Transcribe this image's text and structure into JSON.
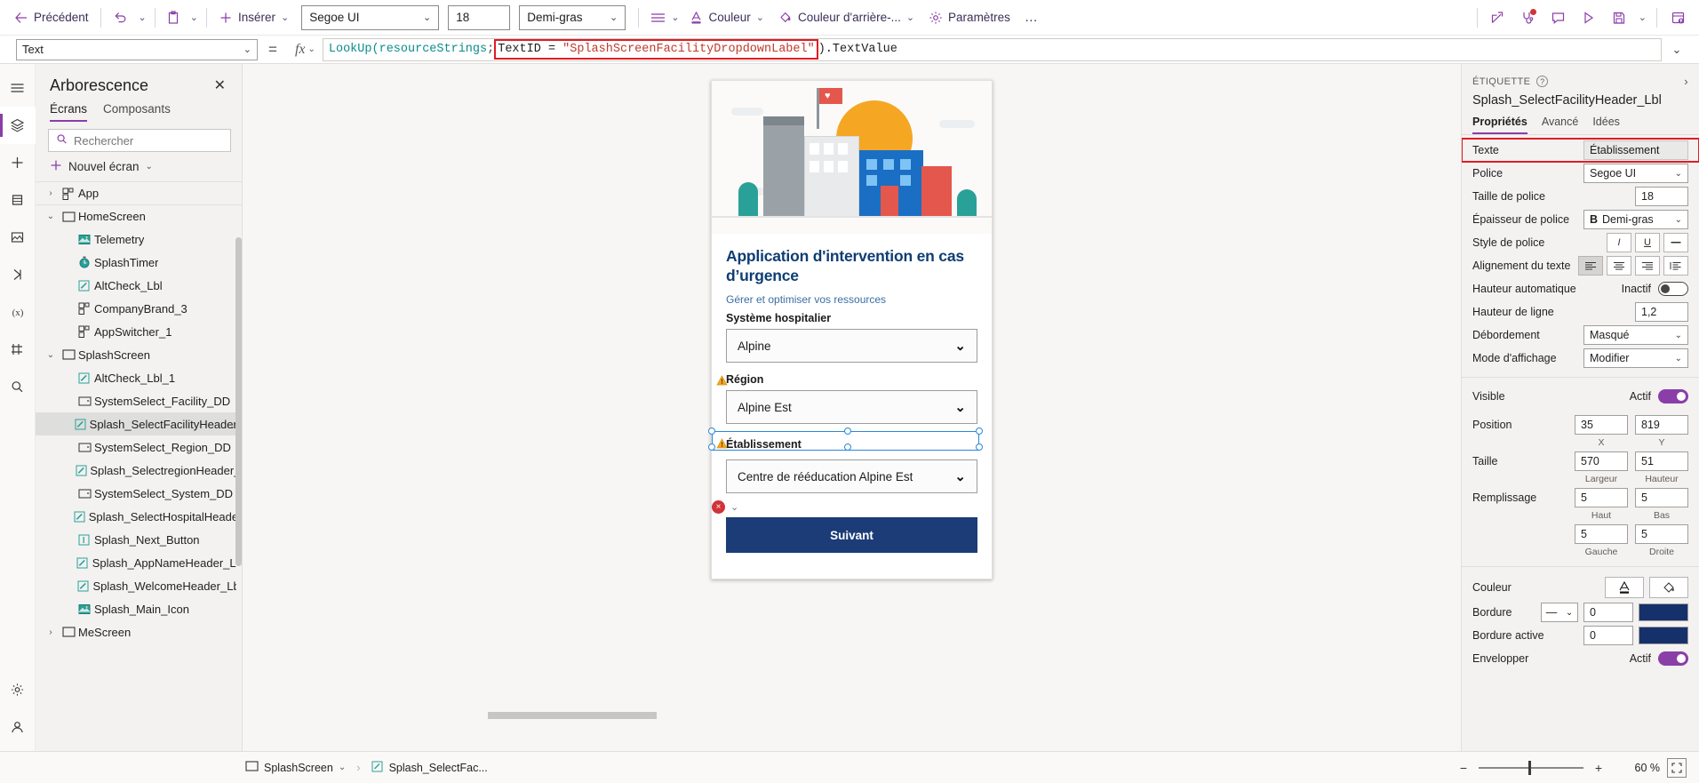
{
  "toolbar": {
    "back_label": "Précédent",
    "undo_icon": "undo-icon",
    "paste_icon": "paste-icon",
    "insert_label": "Insérer",
    "font_value": "Segoe UI",
    "font_size_value": "18",
    "font_weight_value": "Demi-gras",
    "align_icon": "align-icon",
    "color_label": "Couleur",
    "fill_label": "Couleur d'arrière-...",
    "settings_label": "Paramètres",
    "overflow_label": "…",
    "right_icons": [
      {
        "name": "share-icon",
        "glyph": "share"
      },
      {
        "name": "app-checker-icon",
        "glyph": "stethoscope",
        "badge": true
      },
      {
        "name": "comments-icon",
        "glyph": "comment"
      },
      {
        "name": "preview-icon",
        "glyph": "play"
      },
      {
        "name": "save-icon",
        "glyph": "save"
      },
      {
        "name": "save-dropdown-icon",
        "glyph": "chevron"
      },
      {
        "name": "publish-icon",
        "glyph": "publish"
      }
    ]
  },
  "formula_bar": {
    "property_value": "Text",
    "equals": "=",
    "fx_label": "fx",
    "formula_prefix": "LookUp(",
    "formula_table": "resourceStrings",
    "formula_semicolon": "; ",
    "formula_highlight": "TextID = \"SplashScreenFacilityDropdownLabel\"",
    "formula_highlight_id": "TextID = ",
    "formula_highlight_string": "\"SplashScreenFacilityDropdownLabel\"",
    "formula_suffix": ").TextValue",
    "expand_icon": "chevron-down-icon"
  },
  "rail": {
    "items": [
      {
        "name": "menu-icon",
        "label": "Menu"
      },
      {
        "name": "tree-view-icon",
        "label": "Arborescence",
        "active": true
      },
      {
        "name": "insert-icon",
        "label": "Insérer"
      },
      {
        "name": "data-icon",
        "label": "Données"
      },
      {
        "name": "media-icon",
        "label": "Médias"
      },
      {
        "name": "power-automate-icon",
        "label": "Power Automate"
      },
      {
        "name": "variables-icon",
        "label": "Variables"
      },
      {
        "name": "components-icon",
        "label": "Composants"
      },
      {
        "name": "search-icon",
        "label": "Rechercher"
      }
    ],
    "bottom_items": [
      {
        "name": "settings-gear-icon",
        "label": "Paramètres"
      },
      {
        "name": "account-icon",
        "label": "Compte"
      }
    ]
  },
  "tree": {
    "title": "Arborescence",
    "close_icon": "close-icon",
    "tabs": [
      {
        "label": "Écrans",
        "active": true
      },
      {
        "label": "Composants",
        "active": false
      }
    ],
    "search_placeholder": "Rechercher",
    "search_value": "",
    "new_screen_label": "Nouvel écran",
    "items": [
      {
        "label": "App",
        "icon": "component-icon",
        "indent": 0,
        "twisty": "collapsed",
        "selected": false,
        "divider": true
      },
      {
        "label": "HomeScreen",
        "icon": "screen-icon",
        "indent": 0,
        "twisty": "expanded",
        "selected": false,
        "divider": true
      },
      {
        "label": "Telemetry",
        "icon": "image-icon",
        "indent": 1,
        "twisty": "",
        "selected": false,
        "divider": false
      },
      {
        "label": "SplashTimer",
        "icon": "timer-icon",
        "indent": 1,
        "twisty": "",
        "selected": false,
        "divider": false
      },
      {
        "label": "AltCheck_Lbl",
        "icon": "label-icon",
        "indent": 1,
        "twisty": "",
        "selected": false,
        "divider": false
      },
      {
        "label": "CompanyBrand_3",
        "icon": "component-icon",
        "indent": 1,
        "twisty": "",
        "selected": false,
        "divider": false
      },
      {
        "label": "AppSwitcher_1",
        "icon": "component-icon",
        "indent": 1,
        "twisty": "",
        "selected": false,
        "divider": false
      },
      {
        "label": "SplashScreen",
        "icon": "screen-icon",
        "indent": 0,
        "twisty": "expanded",
        "selected": false,
        "divider": false
      },
      {
        "label": "AltCheck_Lbl_1",
        "icon": "label-icon",
        "indent": 1,
        "twisty": "",
        "selected": false,
        "divider": false
      },
      {
        "label": "SystemSelect_Facility_DD",
        "icon": "dropdown-icon",
        "indent": 1,
        "twisty": "",
        "selected": false,
        "divider": false
      },
      {
        "label": "Splash_SelectFacilityHeader_Lbl",
        "icon": "label-icon",
        "indent": 1,
        "twisty": "",
        "selected": true,
        "divider": false,
        "dots": "…"
      },
      {
        "label": "SystemSelect_Region_DD",
        "icon": "dropdown-icon",
        "indent": 1,
        "twisty": "",
        "selected": false,
        "divider": false
      },
      {
        "label": "Splash_SelectregionHeader_Lbl",
        "icon": "label-icon",
        "indent": 1,
        "twisty": "",
        "selected": false,
        "divider": false
      },
      {
        "label": "SystemSelect_System_DD",
        "icon": "dropdown-icon",
        "indent": 1,
        "twisty": "",
        "selected": false,
        "divider": false
      },
      {
        "label": "Splash_SelectHospitalHeader_Lbl",
        "icon": "label-icon",
        "indent": 1,
        "twisty": "",
        "selected": false,
        "divider": false
      },
      {
        "label": "Splash_Next_Button",
        "icon": "button-icon",
        "indent": 1,
        "twisty": "",
        "selected": false,
        "divider": false
      },
      {
        "label": "Splash_AppNameHeader_Lbl",
        "icon": "label-icon",
        "indent": 1,
        "twisty": "",
        "selected": false,
        "divider": false
      },
      {
        "label": "Splash_WelcomeHeader_Lbl",
        "icon": "label-icon",
        "indent": 1,
        "twisty": "",
        "selected": false,
        "divider": false
      },
      {
        "label": "Splash_Main_Icon",
        "icon": "image-icon",
        "indent": 1,
        "twisty": "",
        "selected": false,
        "divider": false
      },
      {
        "label": "MeScreen",
        "icon": "screen-icon",
        "indent": 0,
        "twisty": "collapsed",
        "selected": false,
        "divider": false
      }
    ]
  },
  "canvas": {
    "app_title": "Application d'intervention en cas d’urgence",
    "app_subtitle": "Gérer et optimiser vos ressources",
    "fields": [
      {
        "label": "Système hospitalier",
        "value": "Alpine",
        "warning": false
      },
      {
        "label": "Région",
        "value": "Alpine Est",
        "warning": true
      },
      {
        "label": "Établissement",
        "value": "Centre de rééducation Alpine Est",
        "warning": true,
        "selected": true
      }
    ],
    "error_badge": "×",
    "next_button": "Suivant"
  },
  "properties": {
    "kicker": "ÉTIQUETTE",
    "help_icon": "help-icon",
    "expand_icon": "chevron-right-icon",
    "control_name": "Splash_SelectFacilityHeader_Lbl",
    "tabs": [
      {
        "label": "Propriétés",
        "active": true
      },
      {
        "label": "Avancé",
        "active": false
      },
      {
        "label": "Idées",
        "active": false
      }
    ],
    "text": {
      "label": "Texte",
      "value": "Établissement",
      "highlighted": true
    },
    "font": {
      "label": "Police",
      "value": "Segoe UI"
    },
    "font_size": {
      "label": "Taille de police",
      "value": "18"
    },
    "font_weight": {
      "label": "Épaisseur de police",
      "value": "Demi-gras",
      "prefix": "B"
    },
    "font_style": {
      "label": "Style de police",
      "options": [
        "I",
        "U",
        "S"
      ]
    },
    "text_align": {
      "label": "Alignement du texte",
      "options": [
        "left",
        "center",
        "right",
        "justify"
      ],
      "selected": 0
    },
    "auto_height": {
      "label": "Hauteur automatique",
      "state": "Inactif",
      "on": false
    },
    "line_height": {
      "label": "Hauteur de ligne",
      "value": "1,2"
    },
    "overflow": {
      "label": "Débordement",
      "value": "Masqué"
    },
    "display_mode": {
      "label": "Mode d'affichage",
      "value": "Modifier"
    },
    "visible": {
      "label": "Visible",
      "state": "Actif",
      "on": true
    },
    "position": {
      "label": "Position",
      "x": "35",
      "y": "819",
      "x_label": "X",
      "y_label": "Y"
    },
    "size": {
      "label": "Taille",
      "w": "570",
      "h": "51",
      "w_label": "Largeur",
      "h_label": "Hauteur"
    },
    "padding": {
      "label": "Remplissage",
      "top": "5",
      "bottom": "5",
      "left": "5",
      "right": "5",
      "top_label": "Haut",
      "bottom_label": "Bas",
      "left_label": "Gauche",
      "right_label": "Droite"
    },
    "color": {
      "label": "Couleur",
      "text_icon": "A",
      "fill_icon": "bucket-icon"
    },
    "border": {
      "label": "Bordure",
      "width": "0",
      "swatch": "#16306b"
    },
    "border_active": {
      "label": "Bordure active",
      "width": "0",
      "swatch": "#16306b"
    },
    "wrap": {
      "label": "Envelopper",
      "state": "Actif",
      "on": true
    }
  },
  "statusbar": {
    "breadcrumb": [
      {
        "label": "SplashScreen",
        "icon": "screen-icon",
        "chevron": true
      },
      {
        "label": "Splash_SelectFac...",
        "icon": "label-icon",
        "chevron": false
      }
    ],
    "zoom_out": "−",
    "zoom_in": "+",
    "zoom_value": "60 %",
    "fit_icon": "fit-screen-icon"
  },
  "colors": {
    "accent": "#8a3ea8",
    "app_primary": "#1b3c77",
    "title": "#0f3d73",
    "warning": "#f5a623",
    "error": "#d13438",
    "selection": "#2b88d8"
  }
}
